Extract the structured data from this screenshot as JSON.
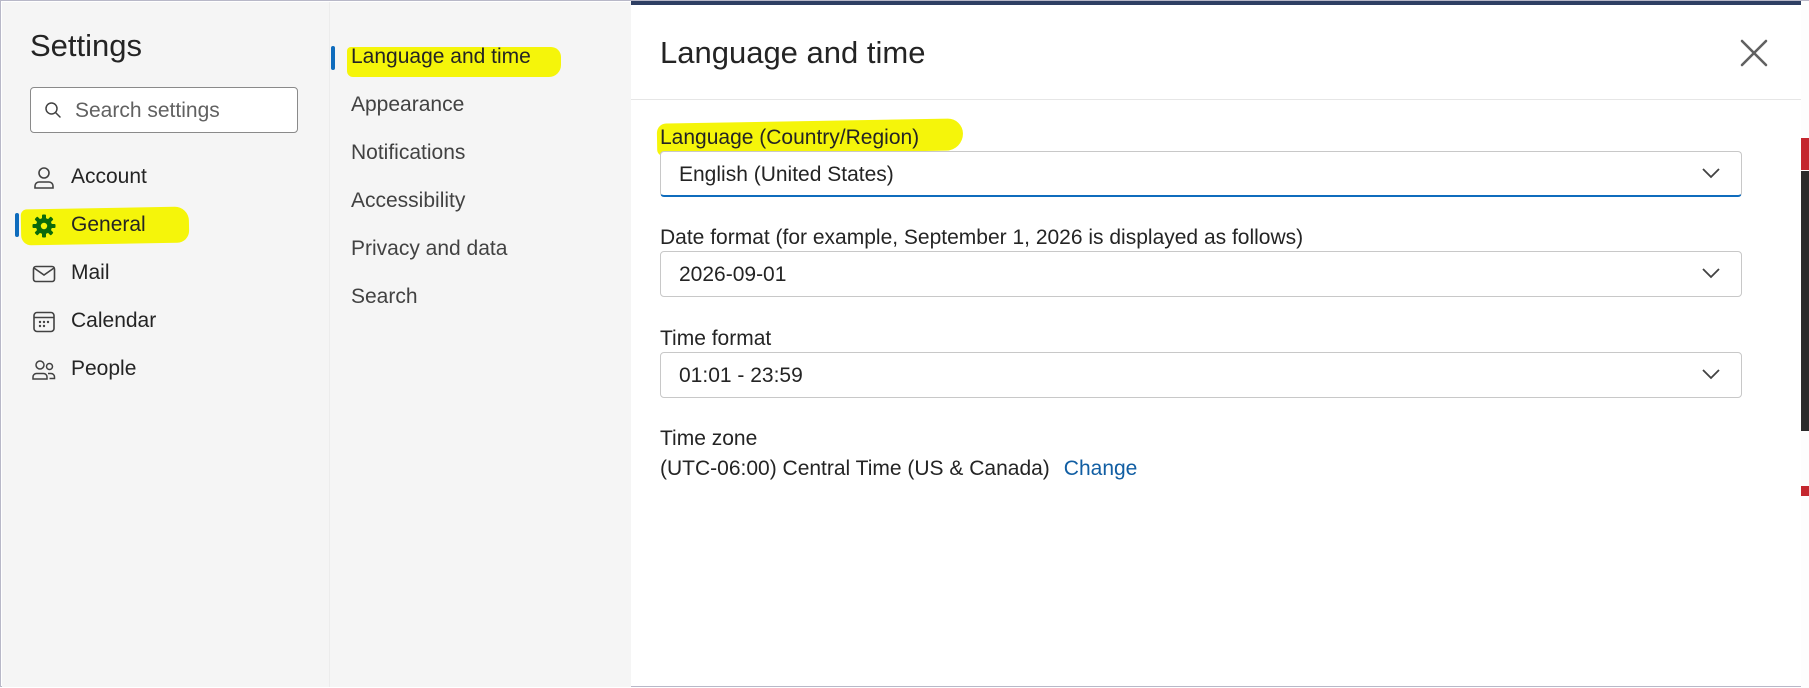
{
  "settings": {
    "title": "Settings",
    "search_placeholder": "Search settings"
  },
  "left_nav": {
    "items": [
      {
        "label": "Account",
        "icon": "person-icon"
      },
      {
        "label": "General",
        "icon": "gear-icon",
        "selected": true
      },
      {
        "label": "Mail",
        "icon": "mail-icon"
      },
      {
        "label": "Calendar",
        "icon": "calendar-icon"
      },
      {
        "label": "People",
        "icon": "people-icon"
      }
    ]
  },
  "sub_nav": {
    "items": [
      {
        "label": "Language and time",
        "selected": true
      },
      {
        "label": "Appearance"
      },
      {
        "label": "Notifications"
      },
      {
        "label": "Accessibility"
      },
      {
        "label": "Privacy and data"
      },
      {
        "label": "Search"
      }
    ]
  },
  "content": {
    "title": "Language and time",
    "language_label": "Language (Country/Region)",
    "language_value": "English (United States)",
    "date_label": "Date format (for example, September 1, 2026 is displayed as follows)",
    "date_value": "2026-09-01",
    "time_label": "Time format",
    "time_value": "01:01 - 23:59",
    "timezone_label": "Time zone",
    "timezone_value": "(UTC-06:00) Central Time (US & Canada)",
    "timezone_change": "Change"
  },
  "colors": {
    "accent": "#0f6cbd",
    "highlight": "#f5f50a",
    "general_icon": "#0b6a0b",
    "link": "#115ea3"
  }
}
